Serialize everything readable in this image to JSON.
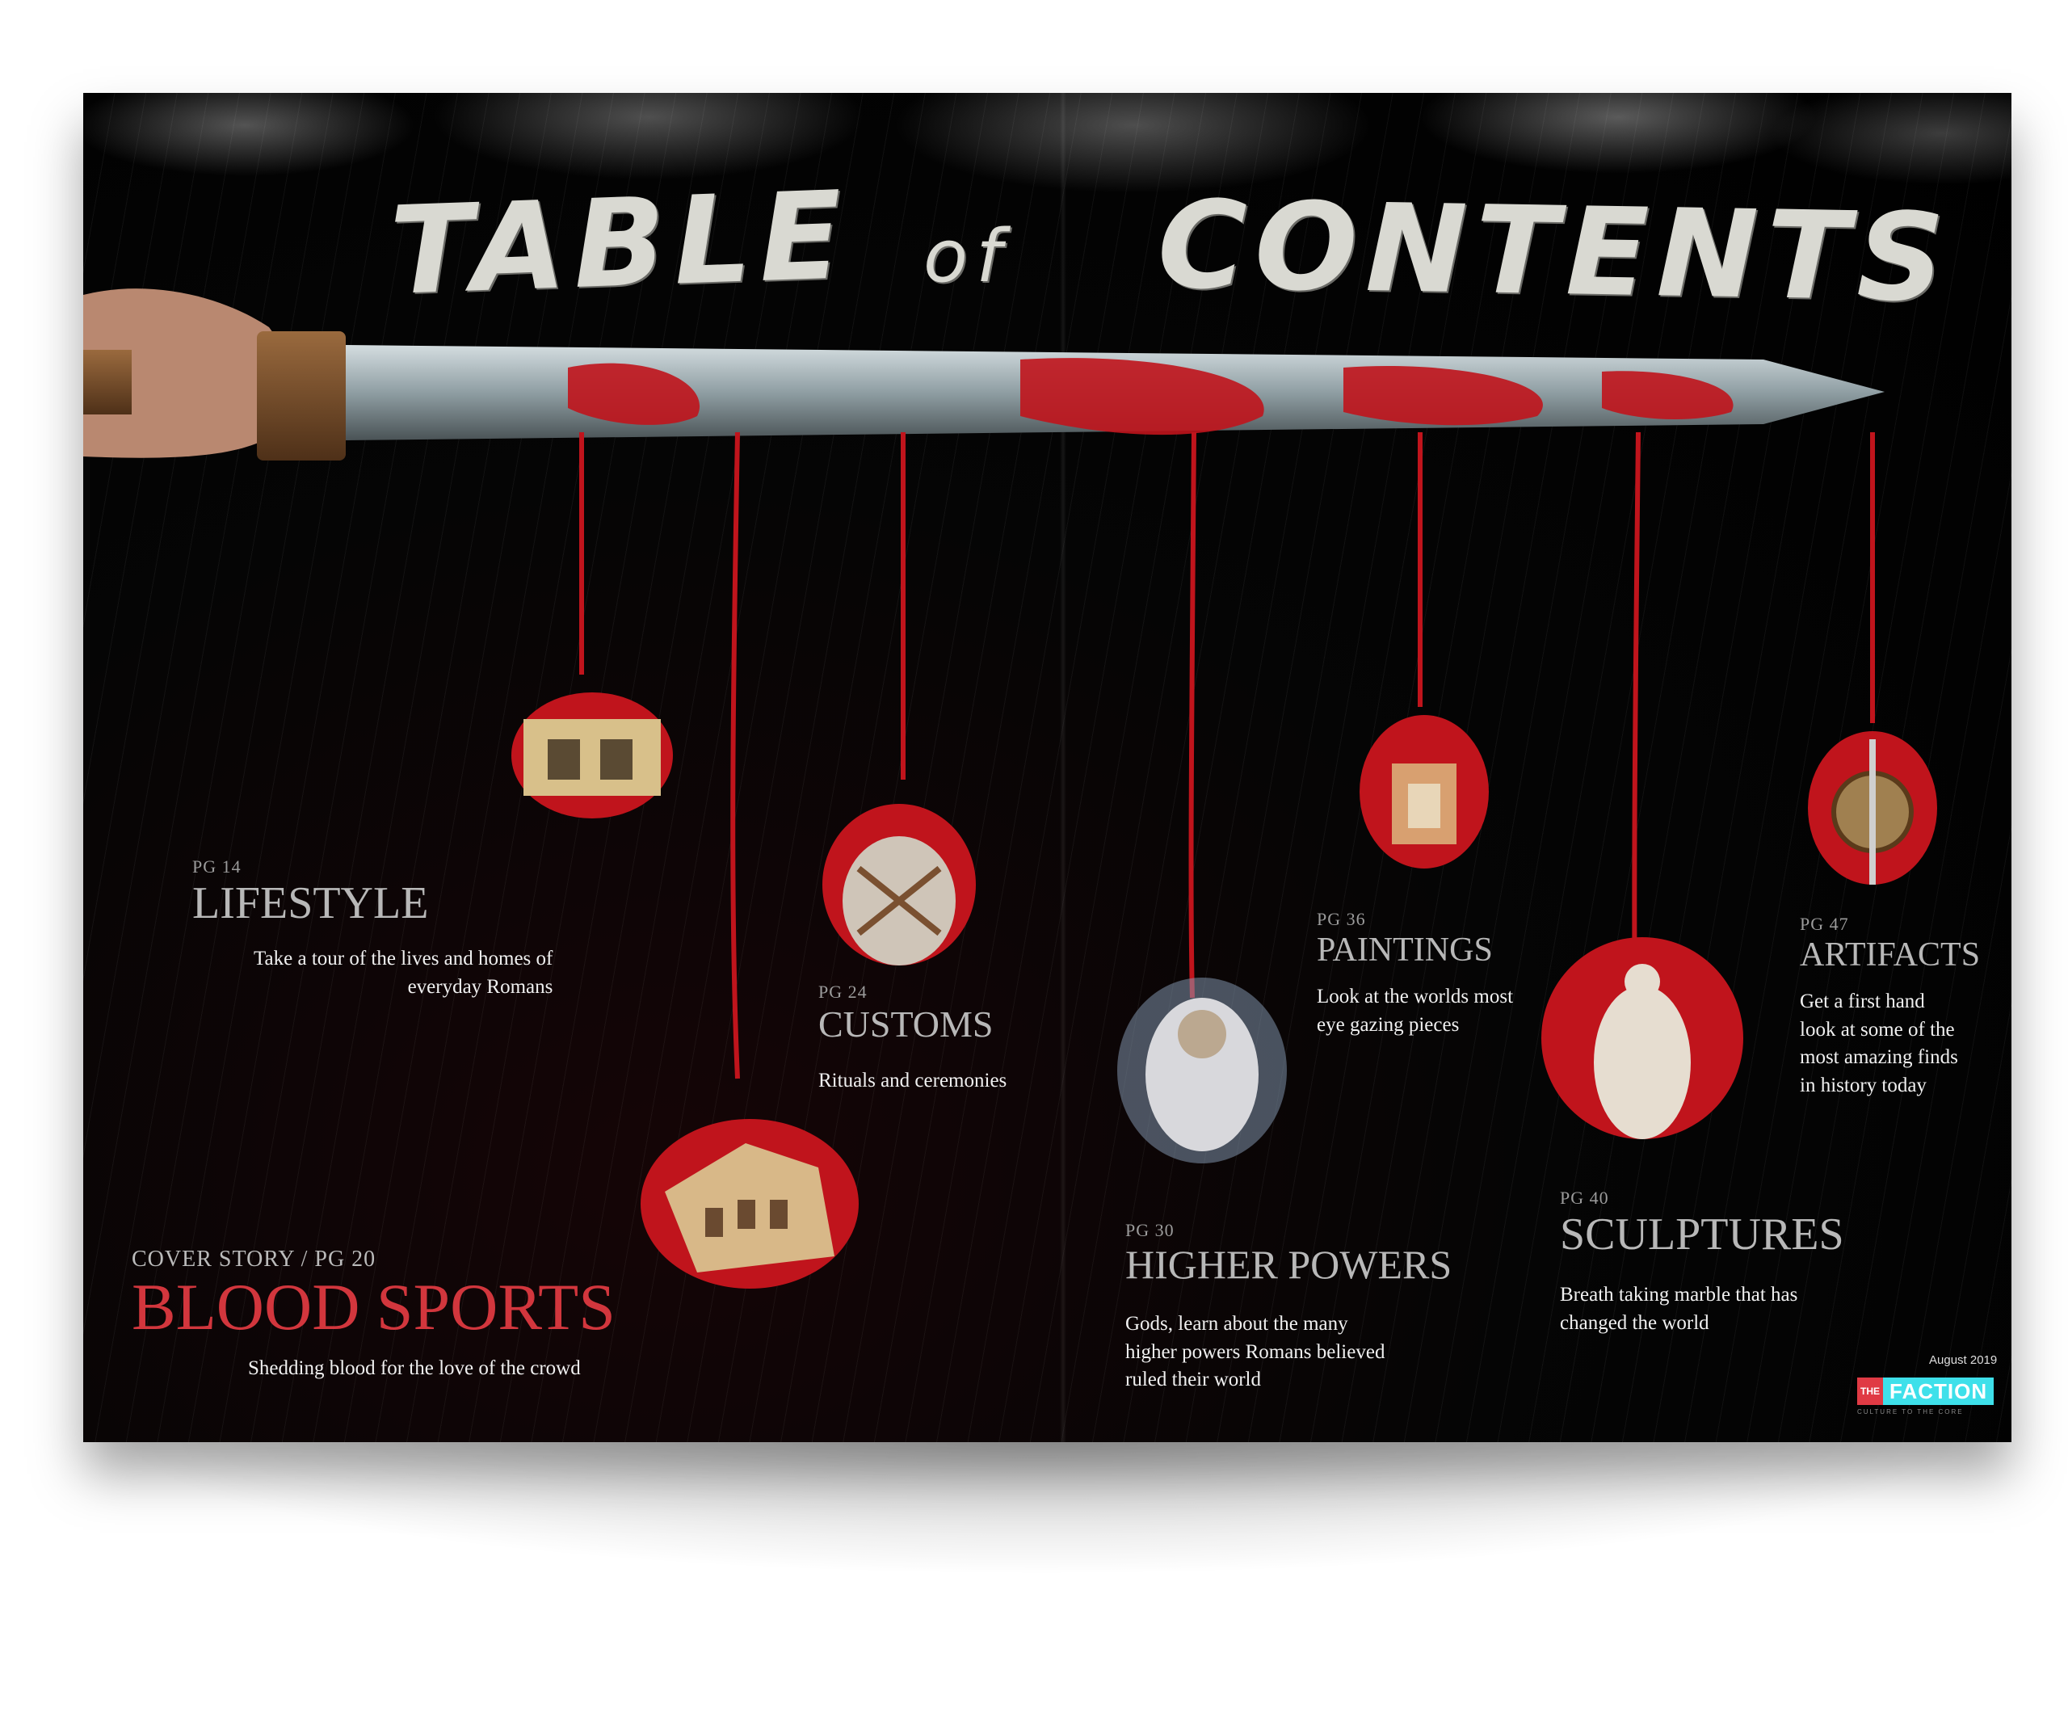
{
  "title": {
    "part1": "TABLE",
    "part2": "of",
    "part3": "CONTENTS"
  },
  "entries": {
    "lifestyle": {
      "page": "PG 14",
      "heading": "LIFESTYLE",
      "description_line1": "Take a tour of the lives and homes of",
      "description_line2": "everyday Romans"
    },
    "customs": {
      "page": "PG 24",
      "heading": "CUSTOMS",
      "description": "Rituals and ceremonies"
    },
    "blood_sports": {
      "page": "COVER STORY / PG 20",
      "heading": "BLOOD SPORTS",
      "description": "Shedding blood for the love of the crowd"
    },
    "higher_powers": {
      "page": "PG 30",
      "heading": "HIGHER POWERS",
      "description_line1": "Gods, learn about the many",
      "description_line2": "higher powers Romans believed",
      "description_line3": "ruled their world"
    },
    "paintings": {
      "page": "PG 36",
      "heading": "PAINTINGS",
      "description_line1": "Look at the worlds most",
      "description_line2": "eye gazing pieces"
    },
    "sculptures": {
      "page": "PG 40",
      "heading": "SCULPTURES",
      "description_line1": "Breath taking marble that has",
      "description_line2": "changed the world"
    },
    "artifacts": {
      "page": "PG 47",
      "heading": "ARTIFACTS",
      "description_line1": "Get a first hand",
      "description_line2": "look at some of the",
      "description_line3": "most amazing finds",
      "description_line4": "in history today"
    }
  },
  "footer": {
    "date": "August 2019",
    "logo_the": "THE",
    "logo_name": "FACTION",
    "tagline": "CULTURE TO THE CORE"
  },
  "colors": {
    "blood": "#c0141c",
    "heading_red": "#d2363d",
    "heading_gray": "#b8b8b8",
    "logo_cyan": "#3ee0ea",
    "logo_red": "#e03a44"
  }
}
